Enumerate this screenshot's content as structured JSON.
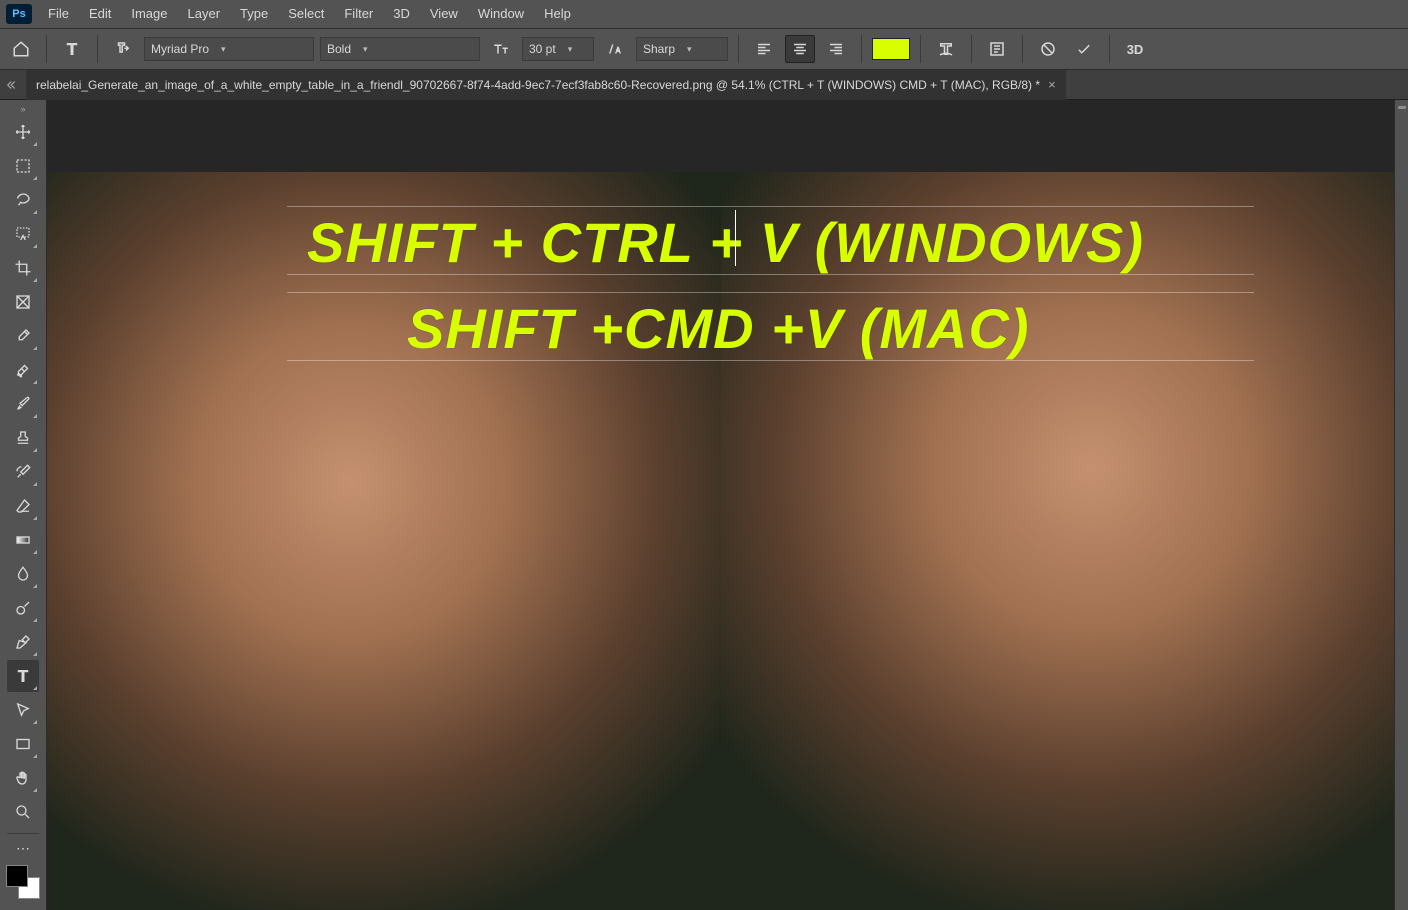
{
  "app": {
    "logo": "Ps"
  },
  "menu": {
    "items": [
      "File",
      "Edit",
      "Image",
      "Layer",
      "Type",
      "Select",
      "Filter",
      "3D",
      "View",
      "Window",
      "Help"
    ]
  },
  "options": {
    "font_family": "Myriad Pro",
    "font_weight": "Bold",
    "font_size": "30 pt",
    "antialias": "Sharp",
    "text_color": "#d7ff00",
    "threeD_label": "3D"
  },
  "tab": {
    "title": "relabelai_Generate_an_image_of_a_white_empty_table_in_a_friendl_90702667-8f74-4add-9ec7-7ecf3fab8c60-Recovered.png @ 54.1% (CTRL + T (WINDOWS) CMD + T (MAC), RGB/8) *"
  },
  "canvas_text": {
    "line1": "SHIFT + CTRL + V (WINDOWS)",
    "line2": "SHIFT +CMD +V (MAC)"
  },
  "tools": {
    "items": [
      "move",
      "marquee",
      "lasso",
      "wand",
      "crop",
      "frame",
      "eyedropper",
      "heal",
      "brush",
      "stamp",
      "history-brush",
      "eraser",
      "gradient",
      "blur",
      "dodge",
      "pen",
      "type",
      "path-select",
      "rectangle",
      "hand",
      "zoom"
    ]
  },
  "colors": {
    "foreground": "#000000",
    "background": "#ffffff"
  }
}
